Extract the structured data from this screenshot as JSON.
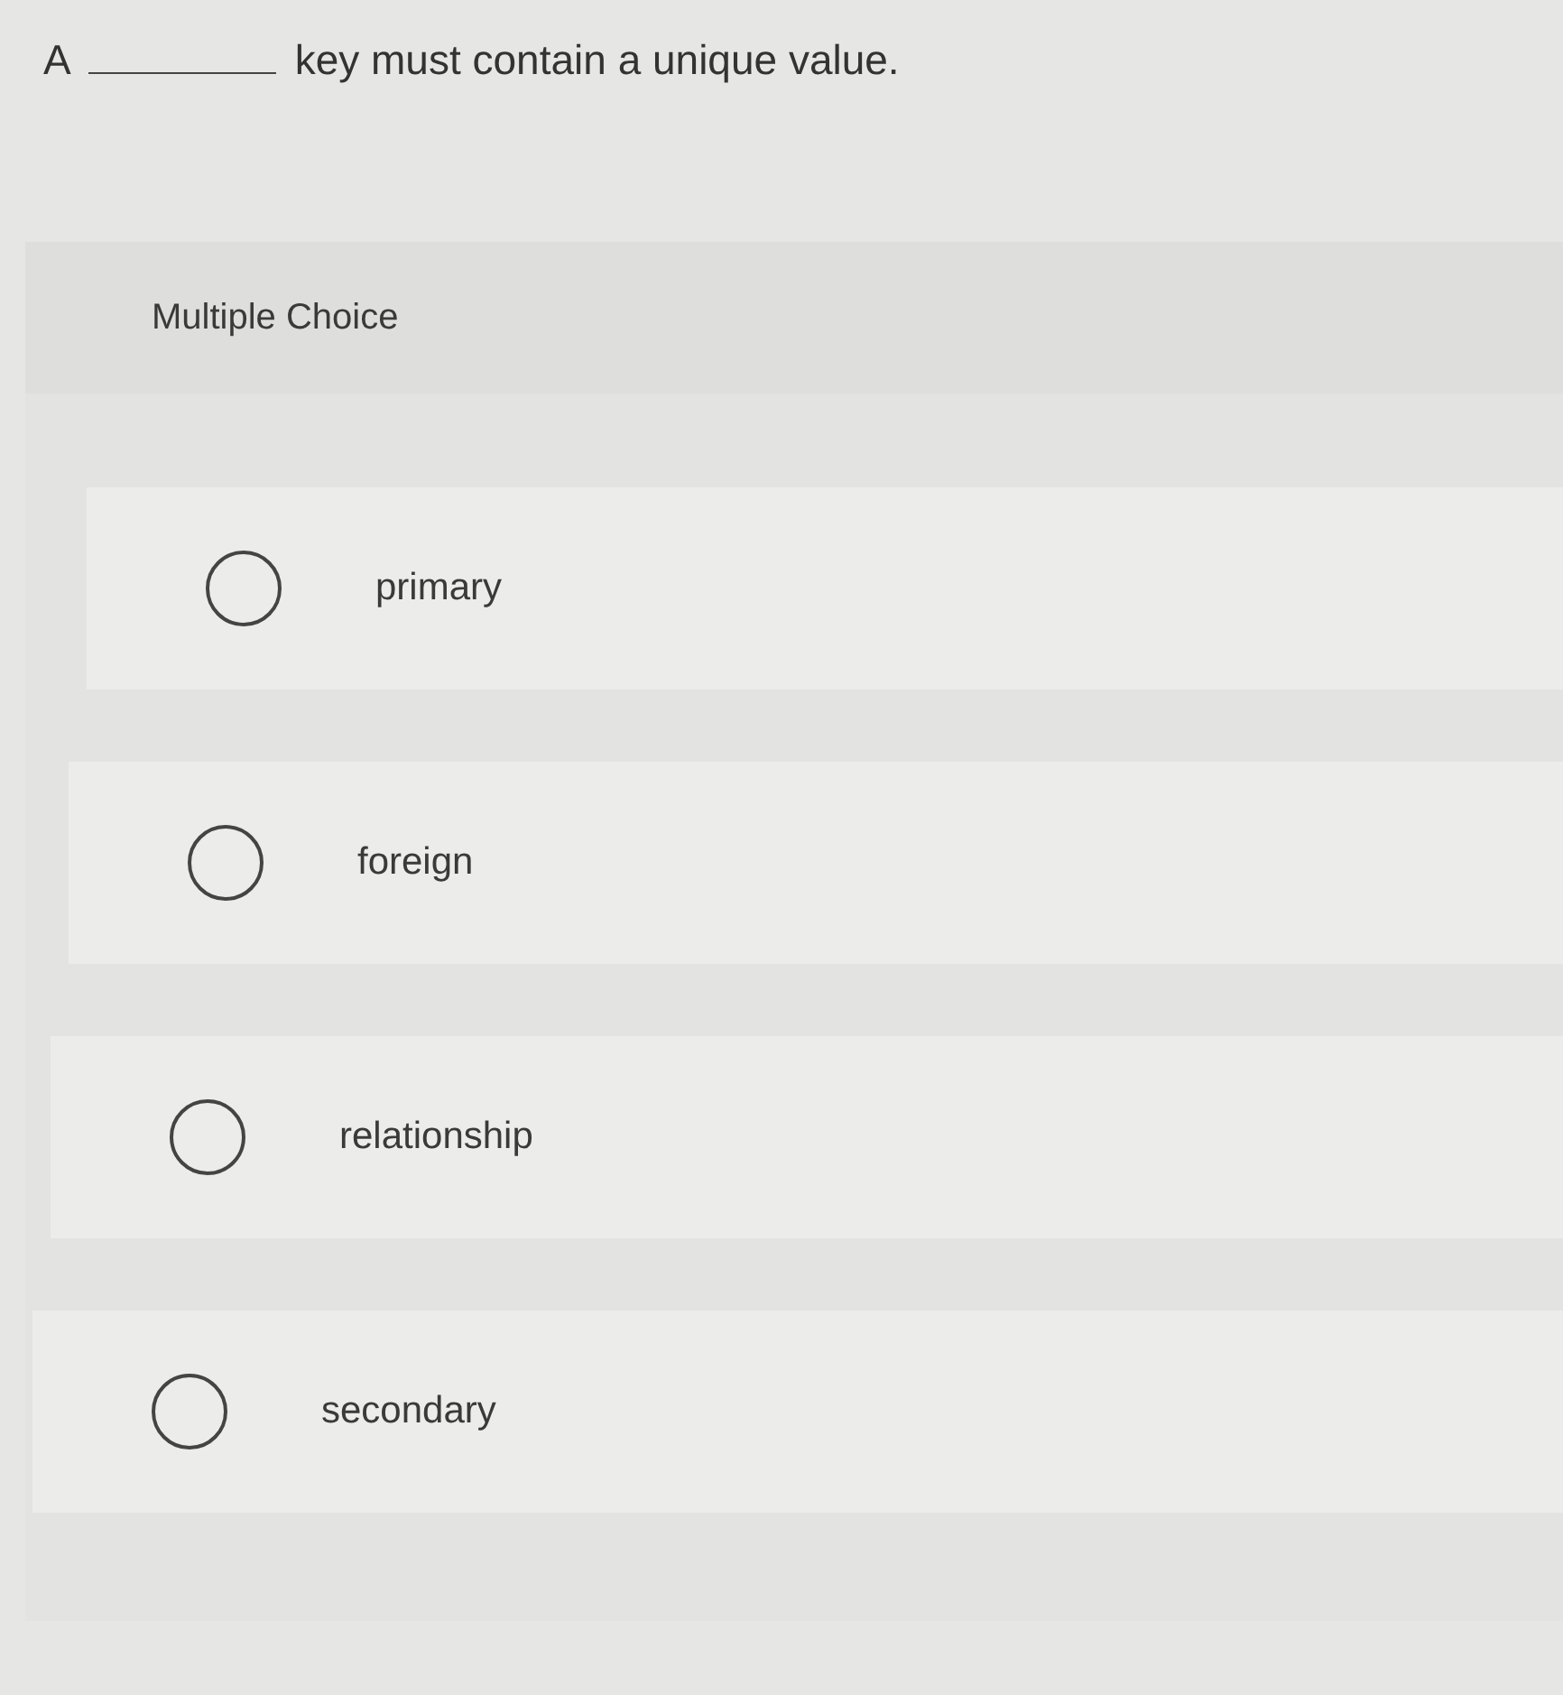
{
  "question": {
    "before": "A",
    "after": "key must contain a unique value."
  },
  "section": {
    "label": "Multiple Choice"
  },
  "options": [
    {
      "label": "primary",
      "selected": false
    },
    {
      "label": "foreign",
      "selected": false
    },
    {
      "label": "relationship",
      "selected": false
    },
    {
      "label": "secondary",
      "selected": false
    }
  ]
}
